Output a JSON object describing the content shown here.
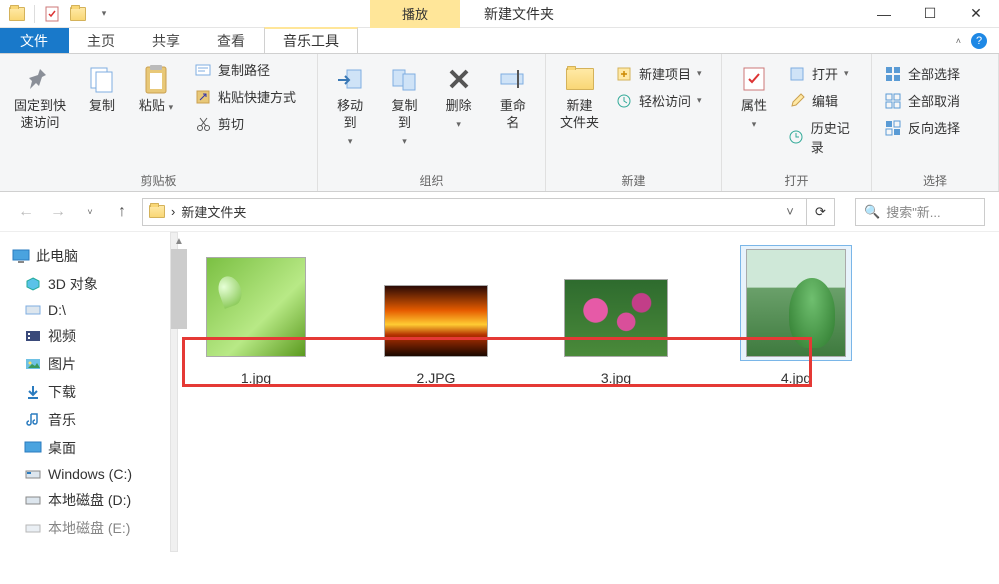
{
  "title": {
    "play": "播放",
    "folder_name": "新建文件夹"
  },
  "tabs": {
    "file": "文件",
    "home": "主页",
    "share": "共享",
    "view": "查看",
    "music_tools": "音乐工具"
  },
  "ribbon": {
    "clipboard": {
      "pin": "固定到快\n速访问",
      "copy": "复制",
      "paste": "粘贴",
      "copy_path": "复制路径",
      "paste_shortcut": "粘贴快捷方式",
      "cut": "剪切",
      "label": "剪贴板"
    },
    "organize": {
      "move_to": "移动到",
      "copy_to": "复制到",
      "delete": "删除",
      "rename": "重命名",
      "label": "组织"
    },
    "new": {
      "new_folder": "新建\n文件夹",
      "new_item": "新建项目",
      "easy_access": "轻松访问",
      "label": "新建"
    },
    "open": {
      "properties": "属性",
      "open": "打开",
      "edit": "编辑",
      "history": "历史记录",
      "label": "打开"
    },
    "select": {
      "select_all": "全部选择",
      "select_none": "全部取消",
      "invert": "反向选择",
      "label": "选择"
    }
  },
  "nav": {
    "location": "新建文件夹",
    "search_placeholder": "搜索\"新..."
  },
  "tree": {
    "root": "此电脑",
    "items": [
      "3D 对象",
      "D:\\",
      "视频",
      "图片",
      "下载",
      "音乐",
      "桌面",
      "Windows (C:)",
      "本地磁盘 (D:)",
      "本地磁盘 (E:)"
    ]
  },
  "files": [
    {
      "name": "1.jpg",
      "selected": false
    },
    {
      "name": "2.JPG",
      "selected": false
    },
    {
      "name": "3.jpg",
      "selected": false
    },
    {
      "name": "4.jpg",
      "selected": true
    }
  ],
  "icons": {
    "checkmark": "✓",
    "chevron_down": "˅",
    "chevron_right": "›",
    "minimize": "—",
    "maximize": "☐",
    "close": "✕",
    "back": "←",
    "forward": "→",
    "up": "↑",
    "refresh": "⟳",
    "search": "🔍"
  },
  "colors": {
    "accent": "#1979ca",
    "play_bg": "#ffe699",
    "highlight_border": "#e53935",
    "selection": "#7ab6e8"
  }
}
